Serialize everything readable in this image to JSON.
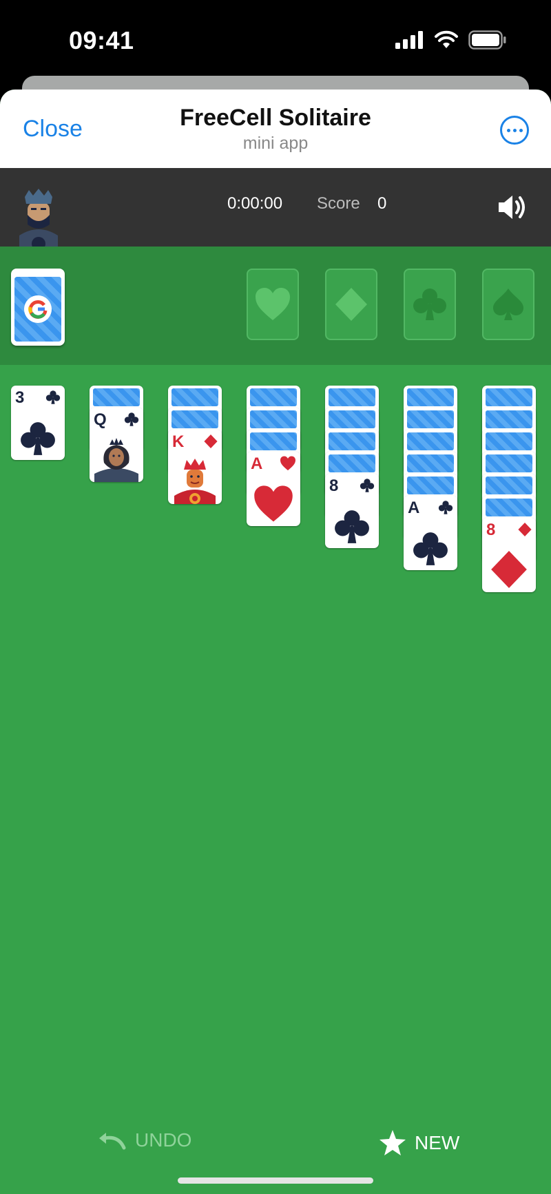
{
  "status_bar": {
    "time": "09:41"
  },
  "header": {
    "close_label": "Close",
    "title": "FreeCell Solitaire",
    "subtitle": "mini app"
  },
  "game_bar": {
    "timer": "0:00:00",
    "score_label": "Score",
    "score_value": "0"
  },
  "foundations": [
    "heart-icon",
    "diamond-icon",
    "club-icon",
    "spade-icon"
  ],
  "tableau": [
    {
      "facedown": 0,
      "top": {
        "rank": "3",
        "suit": "club",
        "color": "black"
      }
    },
    {
      "facedown": 1,
      "top": {
        "rank": "Q",
        "suit": "club",
        "color": "black",
        "face": "queen"
      }
    },
    {
      "facedown": 2,
      "top": {
        "rank": "K",
        "suit": "diamond",
        "color": "red",
        "face": "king"
      }
    },
    {
      "facedown": 3,
      "top": {
        "rank": "A",
        "suit": "heart",
        "color": "red"
      }
    },
    {
      "facedown": 4,
      "top": {
        "rank": "8",
        "suit": "club",
        "color": "black"
      }
    },
    {
      "facedown": 5,
      "top": {
        "rank": "A",
        "suit": "club",
        "color": "black"
      }
    },
    {
      "facedown": 6,
      "top": {
        "rank": "8",
        "suit": "diamond",
        "color": "red"
      }
    }
  ],
  "tableau_labels": {
    "c0": "3",
    "c1": "Q",
    "c2": "K",
    "c3": "A",
    "c4": "8",
    "c5": "A",
    "c6": "8"
  },
  "footer": {
    "undo_label": "UNDO",
    "new_label": "NEW"
  },
  "colors": {
    "felt": "#36a24a",
    "felt_dark": "#2e8a3e",
    "accent": "#1a82e6",
    "red_suit": "#d72a37",
    "black_suit": "#1c2540"
  }
}
